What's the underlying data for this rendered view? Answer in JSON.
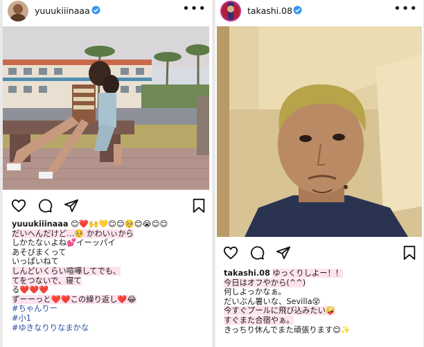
{
  "left_post": {
    "username": "yuuukiiinaaa",
    "more_label": "•••",
    "caption": {
      "line1_text": "😊❤️🙌💛😊😊🥺😊😭😊😊",
      "line2": "だいへんだけど…🥺 かわいぃから",
      "line3": "しかたなぃよね💕イーッパイ",
      "line4": "あそびまくって",
      "line5": "いっぱいねて",
      "line6": "しんどいくらい喧嘩してでも、",
      "line7": "てをつないで、寝て",
      "line8": "る❤️❤️❤️",
      "line9": "ずーーっと❤️❤️この繰り返し❤️😂",
      "tags": [
        "#ちゃんりー",
        "#小1",
        "#ゆきなりりなまかな"
      ]
    }
  },
  "right_post": {
    "username": "takashi.08",
    "more_label": "•••",
    "caption": {
      "line1_text": "ゆっくりしよー！！",
      "line2": "今日はオフやから(^^)",
      "line3": "何しよっかなぁ。",
      "line4": "だいぶん暑いな、Sevilla😵",
      "line5": "今すぐプールに飛び込みたい🤪",
      "line6": "すぐまた合宿やぁ。",
      "line7": "きっちり休んでまた頑張ります😊✨"
    }
  },
  "icons": [
    "heart-icon",
    "comment-icon",
    "share-icon",
    "bookmark-icon",
    "verified-badge-icon",
    "more-options-icon"
  ],
  "colors": {
    "verified": "#3897f0",
    "hashtag": "#2b4fa0",
    "highlight": "#fde3ee"
  }
}
